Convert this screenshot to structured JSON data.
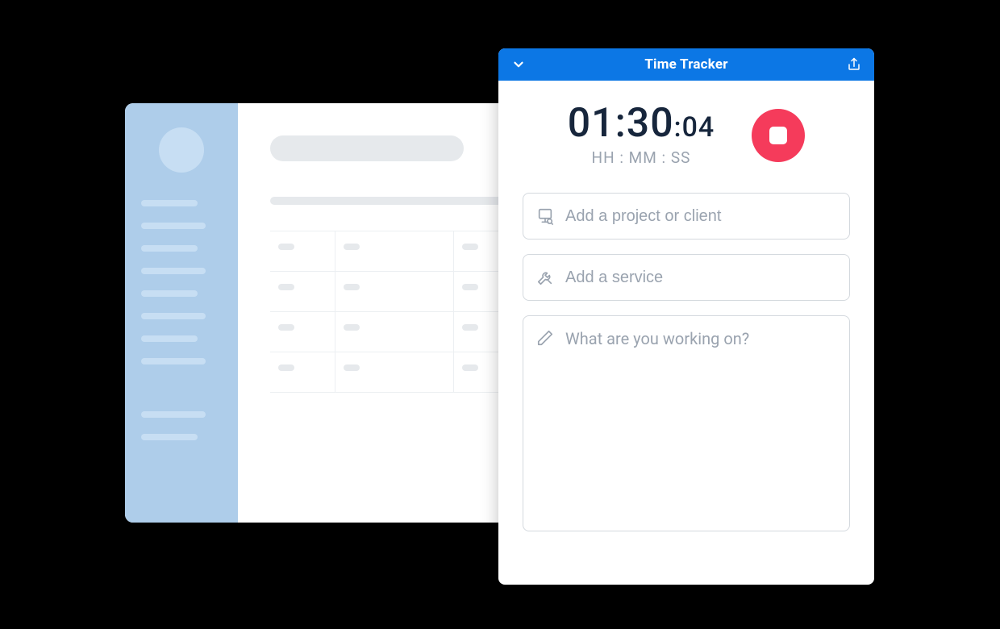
{
  "tracker": {
    "header_title": "Time Tracker",
    "timer_main": "01:30",
    "timer_colon": ":",
    "timer_seconds": "04",
    "timer_sub": "HH : MM : SS",
    "project_placeholder": "Add a project or client",
    "service_placeholder": "Add a service",
    "notes_placeholder": "What are you working on?"
  },
  "colors": {
    "primary": "#0C77E5",
    "stop": "#f53b5b"
  }
}
